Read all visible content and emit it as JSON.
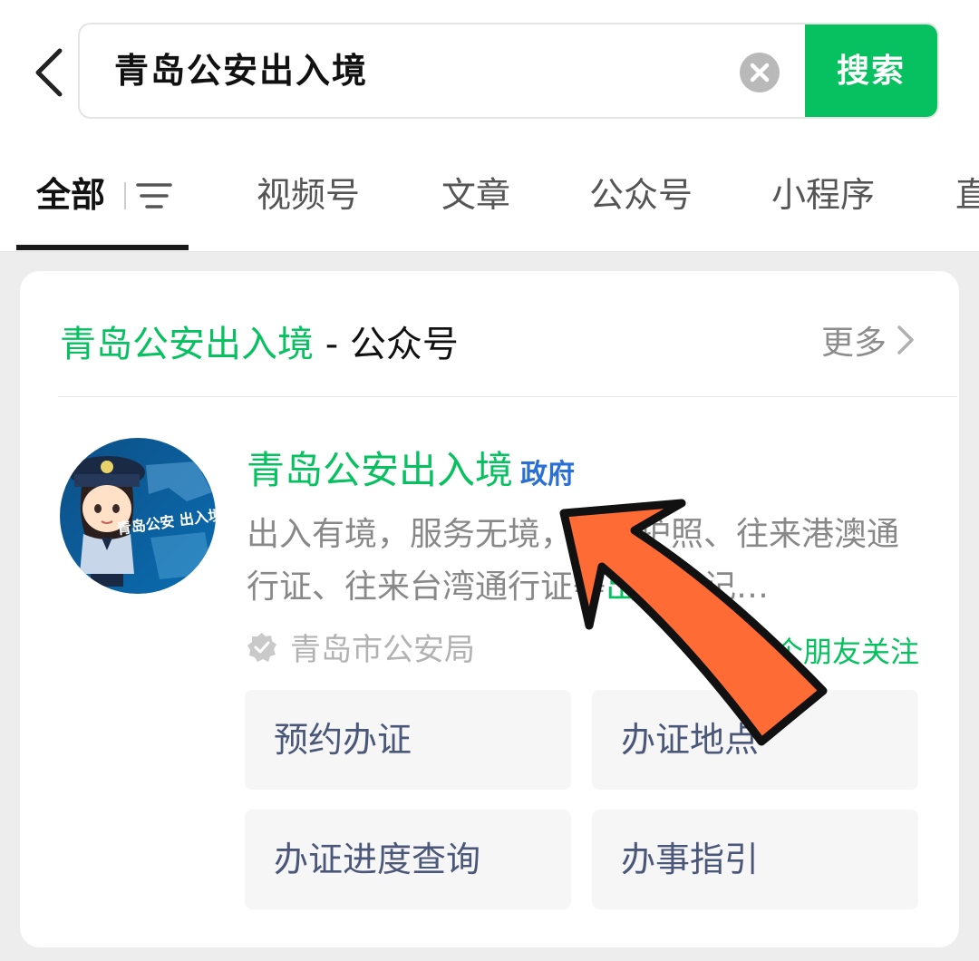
{
  "search": {
    "query": "青岛公安出入境",
    "button_label": "搜索"
  },
  "tabs": [
    {
      "label": "全部"
    },
    {
      "label": "视频号"
    },
    {
      "label": "文章"
    },
    {
      "label": "公众号"
    },
    {
      "label": "小程序"
    },
    {
      "label": "直"
    }
  ],
  "section": {
    "title_highlight": "青岛公安出入境",
    "title_suffix": " - 公众号",
    "more_label": "更多"
  },
  "account": {
    "name": "青岛公安出入境",
    "badge": "政府",
    "desc_1": "出入有境，服务无境，提供护照、往来港澳通行证、往来台湾通行证等",
    "desc_2": "出入境",
    "desc_3": "记…",
    "verified_by": "青岛市公安局",
    "friends_text": "1个朋友关注",
    "avatar_caption": "青岛公安 出入境"
  },
  "menu": [
    {
      "label": "预约办证"
    },
    {
      "label": "办证地点"
    },
    {
      "label": "办证进度查询"
    },
    {
      "label": "办事指引"
    }
  ],
  "colors": {
    "brand_green": "#07c160",
    "gov_blue": "#2a6fd6",
    "arrow_orange": "#ff6b35",
    "menu_text": "#4a5779"
  },
  "icons": {
    "back": "chevron-left-icon",
    "clear": "close-circle-icon",
    "filter": "filter-icon",
    "more": "chevron-right-icon",
    "verified": "verified-badge-icon"
  }
}
